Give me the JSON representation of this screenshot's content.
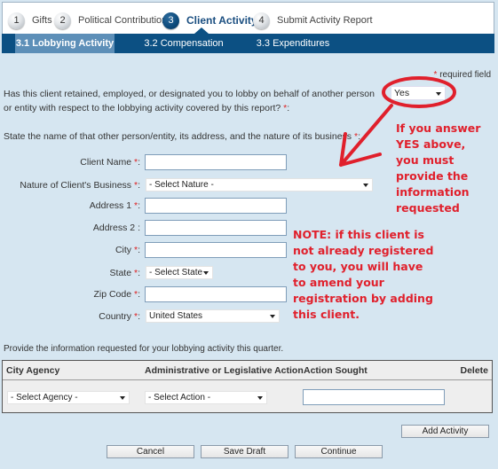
{
  "steps": [
    {
      "number": "1",
      "label": "Gifts",
      "active": false
    },
    {
      "number": "2",
      "label": "Political Contributions",
      "active": false
    },
    {
      "number": "3",
      "label": "Client Activity",
      "active": true
    },
    {
      "number": "4",
      "label": "Submit Activity Report",
      "active": false
    }
  ],
  "subtabs": [
    {
      "label": "3.1 Lobbying Activity",
      "active": true
    },
    {
      "label": "3.2 Compensation",
      "active": false
    },
    {
      "label": "3.3 Expenditures",
      "active": false
    }
  ],
  "required_star": "*",
  "required_note": "required field",
  "question": {
    "text": "Has this client retained, employed, or designated you to lobby on behalf of another person or entity with respect to the lobbying activity covered by this report?",
    "suffix": ":",
    "selected": "Yes"
  },
  "state_prompt": "State the name of that other person/entity, its address, and the nature of its business",
  "fields": {
    "client_name": {
      "label": "Client Name",
      "value": ""
    },
    "nature": {
      "label": "Nature of Client's Business",
      "selected": "- Select Nature -"
    },
    "address1": {
      "label": "Address 1",
      "value": ""
    },
    "address2": {
      "label": "Address 2 :",
      "value": ""
    },
    "city": {
      "label": "City",
      "value": ""
    },
    "state": {
      "label": "State",
      "selected": "- Select State -"
    },
    "zip": {
      "label": "Zip Code",
      "value": ""
    },
    "country": {
      "label": "Country",
      "selected": "United States"
    }
  },
  "annotations": {
    "yes_note": [
      "If you answer",
      "YES above,",
      "you must",
      "provide the",
      "information",
      "requested"
    ],
    "registration_note": [
      "NOTE: if this client is",
      "not already registered",
      "to you, you will have",
      "to amend your",
      "registration by adding",
      "this client."
    ],
    "color": "#e0202c"
  },
  "activity": {
    "prompt": "Provide the information requested for your lobbying activity this quarter.",
    "columns": [
      "City Agency",
      "Administrative or Legislative Action",
      "Action Sought",
      "Delete"
    ],
    "row": {
      "agency": "- Select Agency -",
      "action": "- Select Action -",
      "action_sought": ""
    }
  },
  "buttons": {
    "add_activity": "Add Activity",
    "cancel": "Cancel",
    "save_draft": "Save Draft",
    "continue": "Continue"
  }
}
